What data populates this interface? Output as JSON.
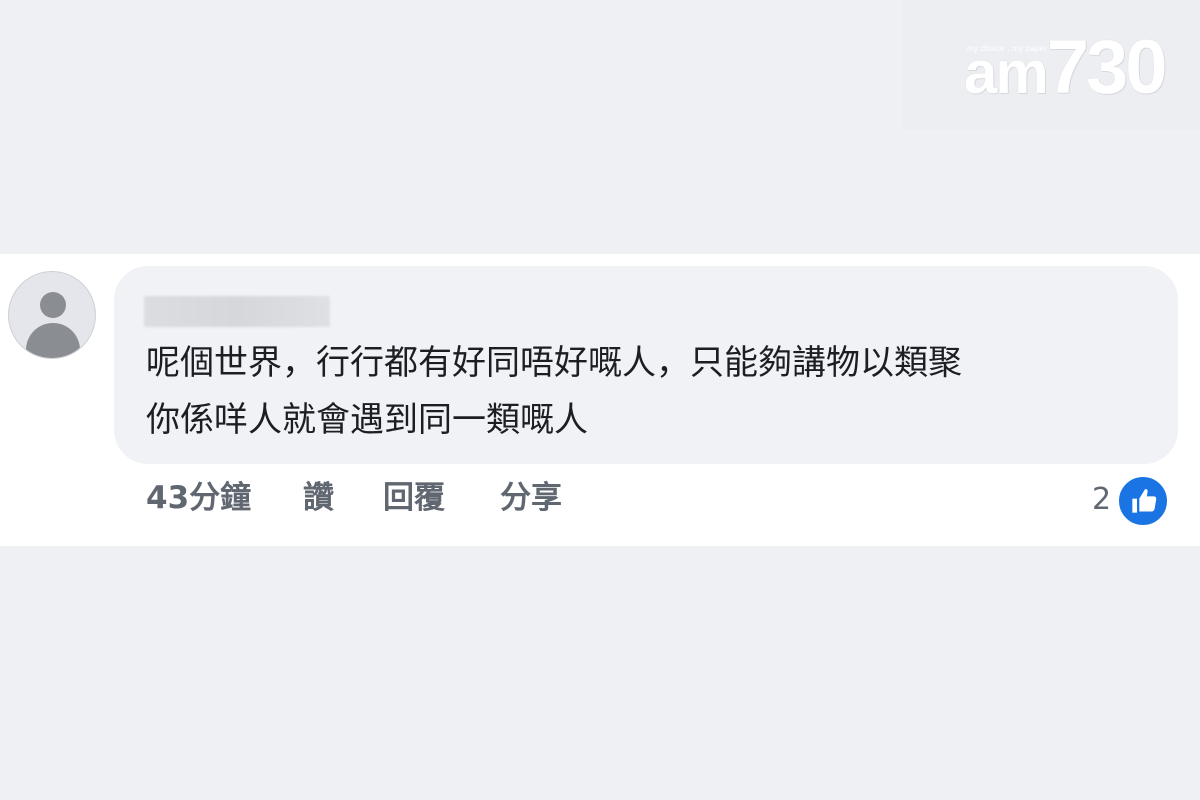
{
  "watermark": {
    "tagline": "my choice . my paper",
    "brand_am": "am",
    "brand_num": "730"
  },
  "comment": {
    "author": "",
    "text_lines": [
      "呢個世界，行行都有好同唔好嘅人，只能夠講物以類聚",
      "你係咩人就會遇到同一類嘅人"
    ],
    "actions": {
      "time": "43分鐘",
      "like": "讚",
      "reply": "回覆",
      "share": "分享"
    },
    "reactions": {
      "count": "2",
      "icon": "thumbs-up-icon",
      "color": "#1b74e4"
    }
  }
}
